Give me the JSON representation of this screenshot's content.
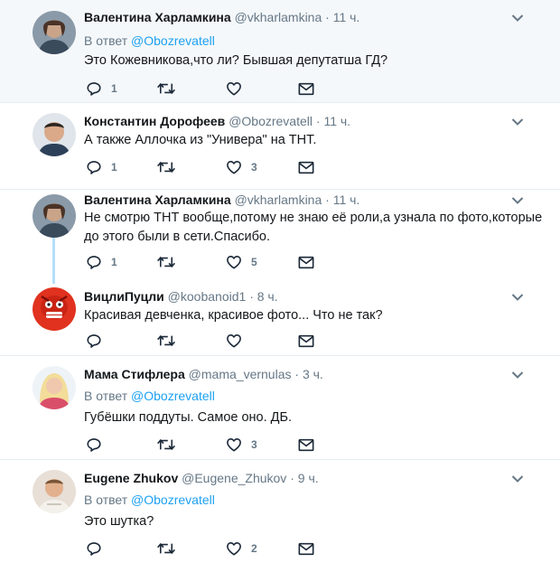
{
  "tweets": [
    {
      "name": "Валентина Харламкина",
      "handle": "@vkharlamkina",
      "time": "11 ч.",
      "reply_label": "В ответ",
      "reply_to": "@Obozrevatell",
      "text": "Это Кожевникова,что ли? Бывшая депутатша ГД?",
      "replies": "1",
      "likes": ""
    },
    {
      "name": "Константин Дорофеев",
      "handle": "@Obozrevatell",
      "time": "11 ч.",
      "text": "А также Аллочка из \"Универа\" на ТНТ.",
      "replies": "1",
      "likes": "3"
    },
    {
      "name": "Валентина Харламкина",
      "handle": "@vkharlamkina",
      "time": "11 ч.",
      "text_line1": "Не смотрю ТНТ вообще,потому не знаю её роли,а узнала по фото,которые",
      "text_line2": "до этого были в сети.Спасибо.",
      "replies": "1",
      "likes": "5"
    },
    {
      "name": "ВицлиПуцли",
      "handle": "@koobanoid1",
      "time": "8 ч.",
      "text": "Красивая девченка, красивое фото... Что не так?",
      "replies": "",
      "likes": ""
    },
    {
      "name": "Мама Стифлера",
      "handle": "@mama_vernulas",
      "time": "3 ч.",
      "reply_label": "В ответ",
      "reply_to": "@Obozrevatell",
      "text": "Губёшки поддуты. Самое оно. ДБ.",
      "replies": "",
      "likes": "3"
    },
    {
      "name": "Eugene Zhukov",
      "handle": "@Eugene_Zhukov",
      "time": "9 ч.",
      "reply_label": "В ответ",
      "reply_to": "@Obozrevatell",
      "text": "Это шутка?",
      "replies": "",
      "likes": "2"
    }
  ],
  "separator": "·",
  "colors": {
    "accent": "#1da1f2",
    "muted": "#657786",
    "thread": "#b5dff8",
    "highlight_bg": "#f5f8fa"
  }
}
